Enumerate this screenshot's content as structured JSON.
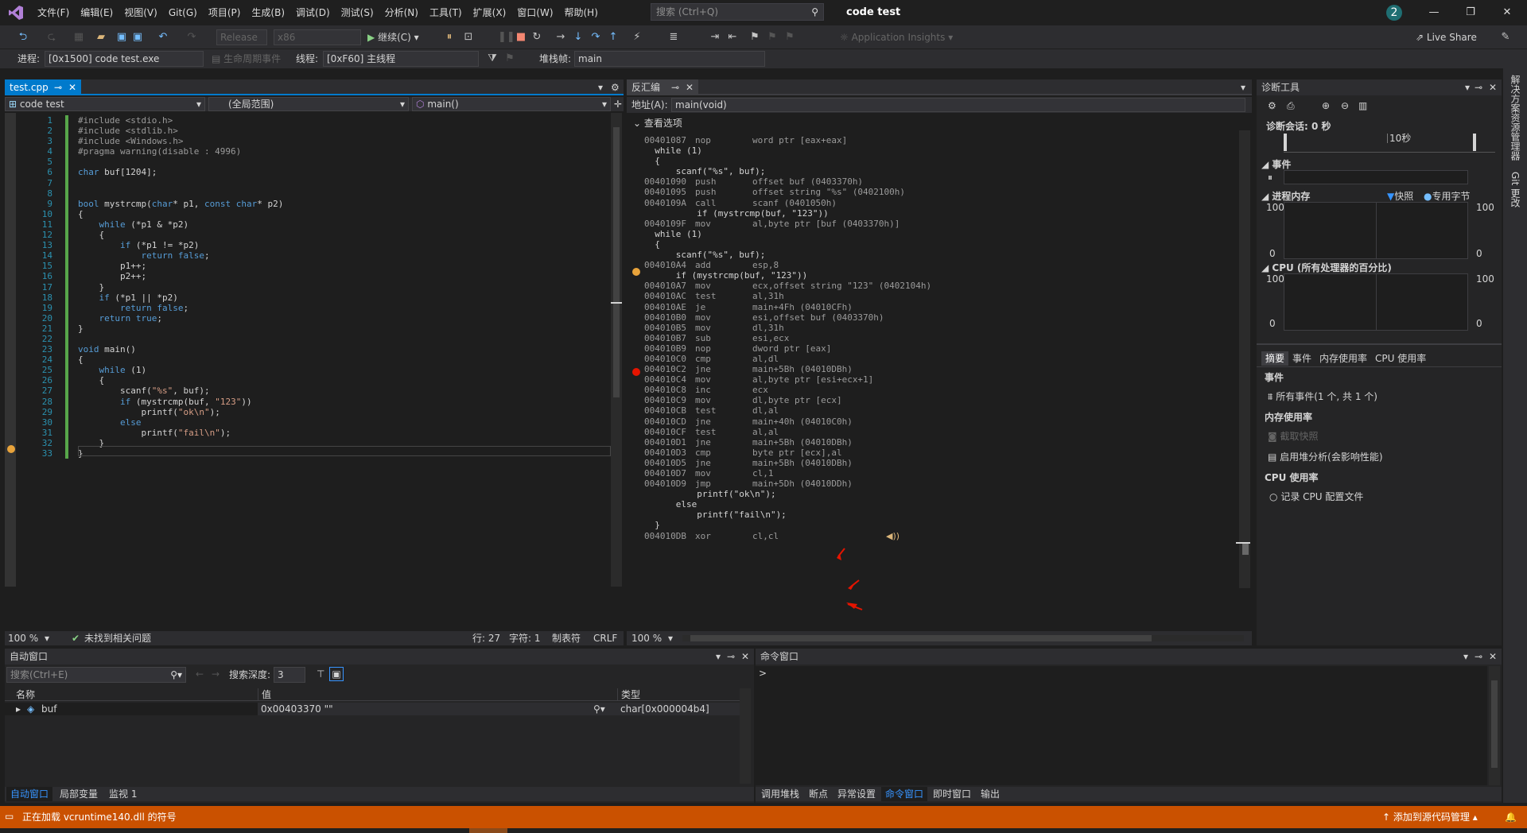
{
  "titlebar": {
    "menus": [
      "文件(F)",
      "编辑(E)",
      "视图(V)",
      "Git(G)",
      "项目(P)",
      "生成(B)",
      "调试(D)",
      "测试(S)",
      "分析(N)",
      "工具(T)",
      "扩展(X)",
      "窗口(W)",
      "帮助(H)"
    ],
    "search_placeholder": "搜索 (Ctrl+Q)",
    "window_title": "code test",
    "notification_count": "2"
  },
  "toolbar": {
    "config": "Release",
    "platform": "x86",
    "continue_label": "继续(C)",
    "app_insights": "Application Insights",
    "live_share": "Live Share"
  },
  "debugbar": {
    "process_label": "进程:",
    "process_value": "[0x1500] code test.exe",
    "lifecycle": "生命周期事件",
    "thread_label": "线程:",
    "thread_value": "[0xF60] 主线程",
    "stack_label": "堆栈帧:",
    "stack_value": "main"
  },
  "editor": {
    "tab": "test.cpp",
    "scope_project": "code test",
    "scope_global": "(全局范围)",
    "scope_func": "main()",
    "lines": [
      "#include <stdio.h>",
      "#include <stdlib.h>",
      "#include <Windows.h>",
      "#pragma warning(disable : 4996)",
      "",
      "char buf[1204];",
      "",
      "",
      "bool mystrcmp(char* p1, const char* p2)",
      "{",
      "    while (*p1 & *p2)",
      "    {",
      "        if (*p1 != *p2)",
      "            return false;",
      "        p1++;",
      "        p2++;",
      "    }",
      "    if (*p1 || *p2)",
      "        return false;",
      "    return true;",
      "}",
      "",
      "void main()",
      "{",
      "    while (1)",
      "    {",
      "        scanf(\"%s\", buf);",
      "        if (mystrcmp(buf, \"123\"))",
      "            printf(\"ok\\n\");",
      "        else",
      "            printf(\"fail\\n\");",
      "    }",
      "}"
    ],
    "zoom": "100 %",
    "issues": "未找到相关问题",
    "row": "行: 27",
    "col": "字符: 1",
    "tabs_mode": "制表符",
    "eol": "CRLF"
  },
  "disasm": {
    "tab": "反汇编",
    "address_label": "地址(A):",
    "address_value": "main(void)",
    "view_options": "查看选项",
    "lines": [
      {
        "a": "00401087",
        "op": "nop",
        "arg": "word ptr [eax+eax]"
      },
      {
        "src": "  while (1)"
      },
      {
        "src": "  {"
      },
      {
        "src": "      scanf(\"%s\", buf);"
      },
      {
        "a": "00401090",
        "op": "push",
        "arg": "offset buf (0403370h)"
      },
      {
        "a": "00401095",
        "op": "push",
        "arg": "offset string \"%s\" (0402100h)"
      },
      {
        "a": "0040109A",
        "op": "call",
        "arg": "scanf (0401050h)"
      },
      {
        "src": "          if (mystrcmp(buf, \"123\"))"
      },
      {
        "a": "0040109F",
        "op": "mov",
        "arg": "al,byte ptr [buf (0403370h)]"
      },
      {
        "src": "  while (1)"
      },
      {
        "src": "  {"
      },
      {
        "src": "      scanf(\"%s\", buf);"
      },
      {
        "a": "004010A4",
        "op": "add",
        "arg": "esp,8"
      },
      {
        "src": "      if (mystrcmp(buf, \"123\"))"
      },
      {
        "a": "004010A7",
        "op": "mov",
        "arg": "ecx,offset string \"123\" (0402104h)"
      },
      {
        "a": "004010AC",
        "op": "test",
        "arg": "al,31h"
      },
      {
        "a": "004010AE",
        "op": "je",
        "arg": "main+4Fh (04010CFh)"
      },
      {
        "a": "004010B0",
        "op": "mov",
        "arg": "esi,offset buf (0403370h)"
      },
      {
        "a": "004010B5",
        "op": "mov",
        "arg": "dl,31h"
      },
      {
        "a": "004010B7",
        "op": "sub",
        "arg": "esi,ecx"
      },
      {
        "a": "004010B9",
        "op": "nop",
        "arg": "dword ptr [eax]"
      },
      {
        "a": "004010C0",
        "op": "cmp",
        "arg": "al,dl"
      },
      {
        "a": "004010C2",
        "op": "jne",
        "arg": "main+5Bh (04010DBh)"
      },
      {
        "a": "004010C4",
        "op": "mov",
        "arg": "al,byte ptr [esi+ecx+1]"
      },
      {
        "a": "004010C8",
        "op": "inc",
        "arg": "ecx"
      },
      {
        "a": "004010C9",
        "op": "mov",
        "arg": "dl,byte ptr [ecx]"
      },
      {
        "a": "004010CB",
        "op": "test",
        "arg": "dl,al"
      },
      {
        "a": "004010CD",
        "op": "jne",
        "arg": "main+40h (04010C0h)"
      },
      {
        "a": "004010CF",
        "op": "test",
        "arg": "al,al"
      },
      {
        "a": "004010D1",
        "op": "jne",
        "arg": "main+5Bh (04010DBh)"
      },
      {
        "a": "004010D3",
        "op": "cmp",
        "arg": "byte ptr [ecx],al"
      },
      {
        "a": "004010D5",
        "op": "jne",
        "arg": "main+5Bh (04010DBh)"
      },
      {
        "a": "004010D7",
        "op": "mov",
        "arg": "cl,1"
      },
      {
        "a": "004010D9",
        "op": "jmp",
        "arg": "main+5Dh (04010DDh)"
      },
      {
        "src": "          printf(\"ok\\n\");"
      },
      {
        "src": "      else"
      },
      {
        "src": "          printf(\"fail\\n\");"
      },
      {
        "src": "  }"
      },
      {
        "a": "004010DB",
        "op": "xor",
        "arg": "cl,cl"
      }
    ],
    "zoom": "100 %"
  },
  "diag": {
    "title": "诊断工具",
    "session": "诊断会话: 0 秒",
    "ruler_mark": "10秒",
    "events": "事件",
    "memory": "进程内存",
    "snapshot": "快照",
    "private_bytes": "专用字节",
    "cpu": "CPU (所有处理器的百分比)",
    "axis_max": "100",
    "axis_min": "0",
    "tabs": [
      "摘要",
      "事件",
      "内存使用率",
      "CPU 使用率"
    ],
    "sec_events": "事件",
    "all_events": "所有事件(1 个, 共 1 个)",
    "sec_memory": "内存使用率",
    "take_snapshot": "截取快照",
    "heap": "启用堆分析(会影响性能)",
    "sec_cpu": "CPU 使用率",
    "cpu_profile": "记录 CPU 配置文件"
  },
  "sidebar_right": [
    "解决方案资源管理器",
    "Git 更改"
  ],
  "autos": {
    "title": "自动窗口",
    "search_placeholder": "搜索(Ctrl+E)",
    "depth_label": "搜索深度:",
    "depth_value": "3",
    "cols": [
      "名称",
      "值",
      "类型"
    ],
    "row": {
      "name": "buf",
      "value": "0x00403370 \"\"",
      "type": "char[0x000004b4]"
    },
    "tabs": [
      "自动窗口",
      "局部变量",
      "监视 1"
    ]
  },
  "command": {
    "title": "命令窗口",
    "prompt": ">",
    "tabs": [
      "调用堆栈",
      "断点",
      "异常设置",
      "命令窗口",
      "即时窗口",
      "输出"
    ]
  },
  "status": {
    "message": "正在加载 vcruntime140.dll 的符号",
    "source_control": "添加到源代码管理"
  }
}
